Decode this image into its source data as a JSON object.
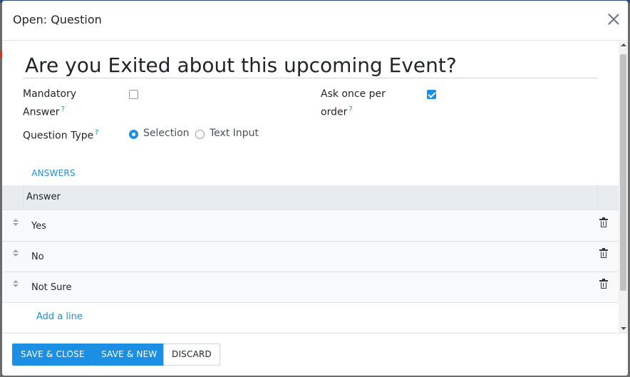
{
  "dialog": {
    "title": "Open: Question"
  },
  "form": {
    "question_title": "Are you Exited about this upcoming Event?",
    "mandatory_label_line1": "Mandatory",
    "mandatory_label_line2": "Answer",
    "mandatory_checked": false,
    "ask_once_label_line1": "Ask once per",
    "ask_once_label_line2": "order",
    "ask_once_checked": true,
    "help_marker": "?",
    "question_type_label": "Question Type",
    "question_type_options": [
      "Selection",
      "Text Input"
    ],
    "question_type_selected": "Selection"
  },
  "tabs": [
    {
      "label": "ANSWERS"
    }
  ],
  "answers_table": {
    "column_header": "Answer",
    "rows": [
      {
        "answer": "Yes"
      },
      {
        "answer": "No"
      },
      {
        "answer": "Not Sure"
      }
    ],
    "add_line_label": "Add a line"
  },
  "footer": {
    "save_close_label": "SAVE & CLOSE",
    "save_new_label": "SAVE & NEW",
    "discard_label": "DISCARD"
  },
  "colors": {
    "accent": "#1a8fe3",
    "help": "#00a09d"
  }
}
